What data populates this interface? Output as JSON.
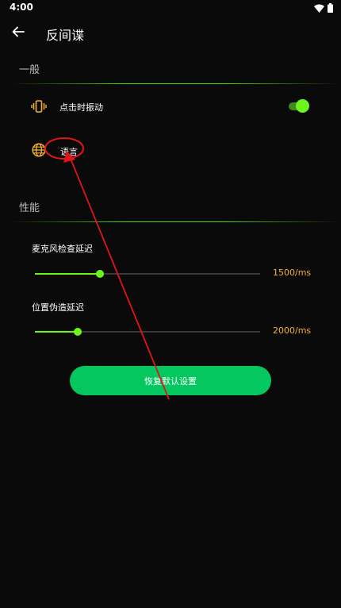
{
  "status_bar": {
    "time": "4:00"
  },
  "app_bar": {
    "title": "反间谍"
  },
  "sections": {
    "general": {
      "header": "一般"
    },
    "performance": {
      "header": "性能"
    }
  },
  "settings": {
    "vibrate": {
      "label": "点击时振动",
      "enabled": true,
      "icon": "vibrate-icon"
    },
    "language": {
      "label": "语言",
      "icon": "globe-icon"
    }
  },
  "sliders": {
    "mic_check_delay": {
      "label": "麦克风检查延迟",
      "value_text": "1500/ms",
      "fraction": 0.29
    },
    "location_spoof_delay": {
      "label": "位置伪造延迟",
      "value_text": "2000/ms",
      "fraction": 0.19
    }
  },
  "buttons": {
    "reset": "恢复默认设置"
  },
  "colors": {
    "accent_green": "#6cf51a",
    "button_green": "#05c760",
    "icon_orange": "#f2b233",
    "annotation_red": "#e0151a",
    "background": "#0a0a0a"
  }
}
